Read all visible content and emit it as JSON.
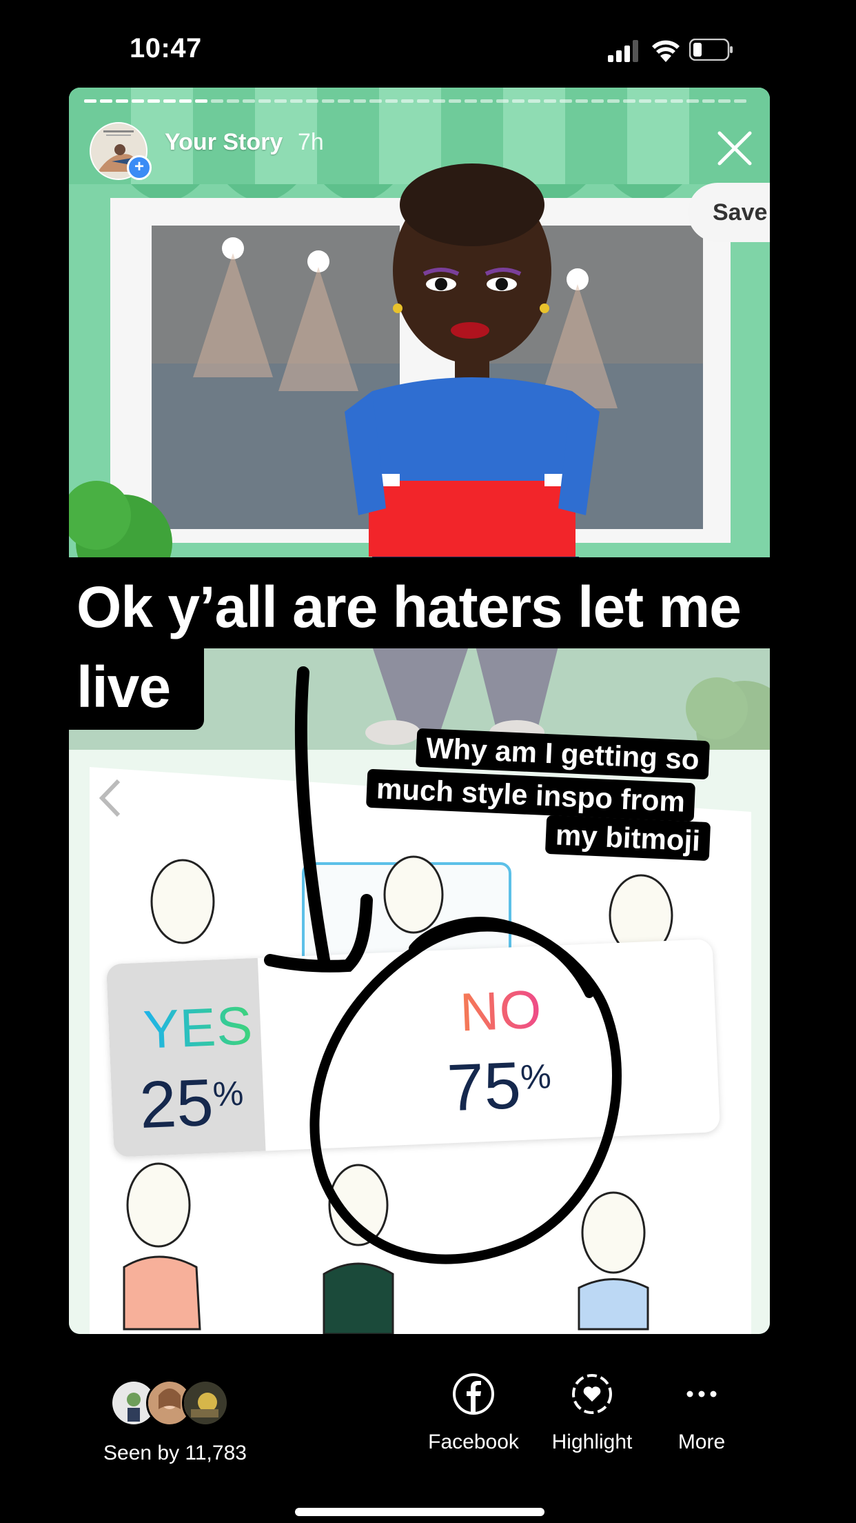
{
  "status_bar": {
    "time": "10:47"
  },
  "story": {
    "name": "Your Story",
    "age": "7h",
    "background_save_label": "Save"
  },
  "caption": {
    "line1": "Ok y’all are haters let me",
    "line2": "live"
  },
  "sticker_text": {
    "line1": "Why am I getting so",
    "line2": "much style inspo from",
    "line3": "my bitmoji"
  },
  "poll": {
    "yes_label": "YES",
    "yes_percent": "25",
    "no_label": "NO",
    "no_percent": "75",
    "percent_sign": "%",
    "yes_fraction": 0.25
  },
  "footer": {
    "seen_label": "Seen by 11,783",
    "actions": [
      {
        "label": "Facebook",
        "icon": "facebook-icon"
      },
      {
        "label": "Highlight",
        "icon": "highlight-icon"
      },
      {
        "label": "More",
        "icon": "more-icon"
      }
    ]
  },
  "colors": {
    "awning_green": "#7fd4a7",
    "yes_gradient": [
      "#1fb3ea",
      "#3ed37a"
    ],
    "no_gradient": [
      "#f57c54",
      "#ee4a8a"
    ],
    "poll_number": "#15284d"
  }
}
